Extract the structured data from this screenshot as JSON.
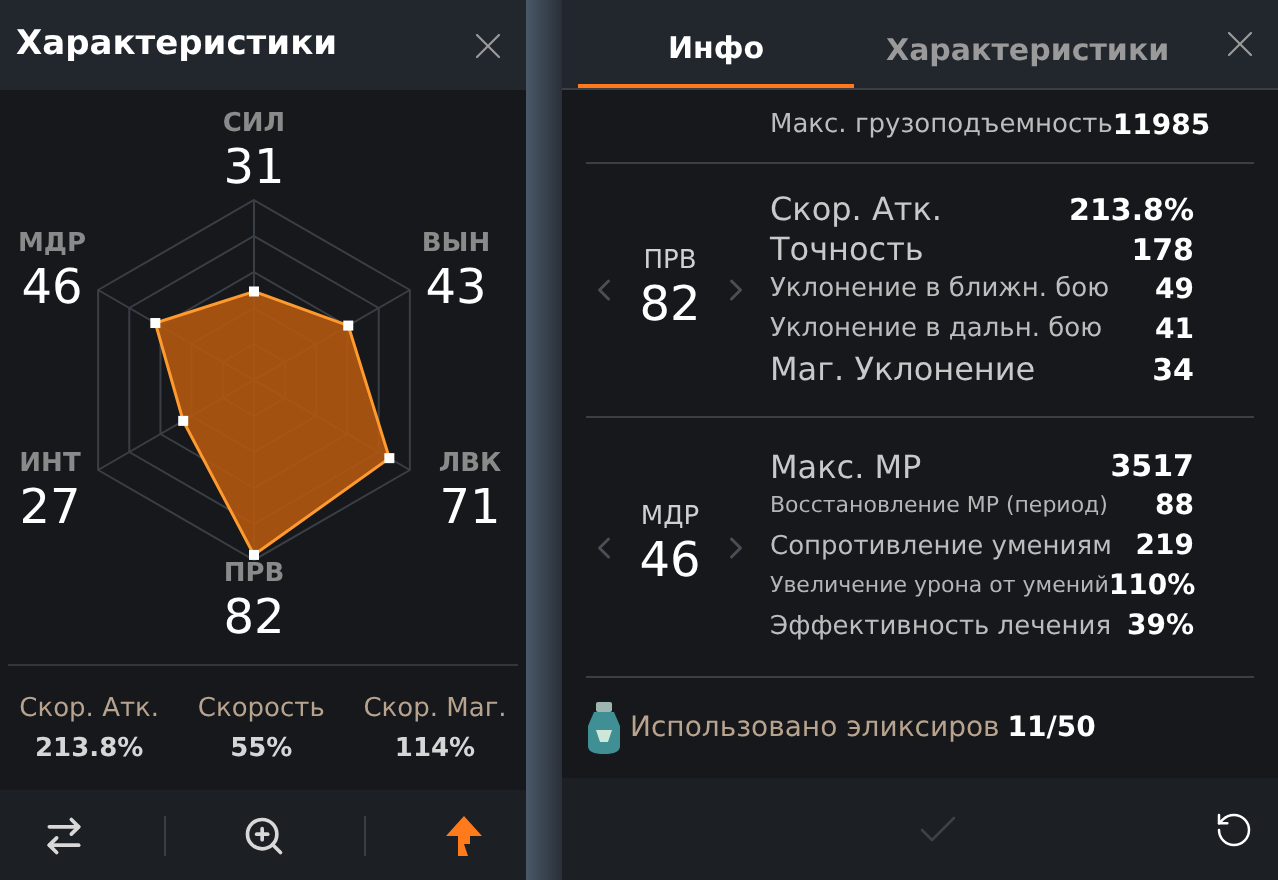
{
  "left_panel": {
    "title": "Характеристики",
    "stats": [
      {
        "label": "СИЛ",
        "value": "31"
      },
      {
        "label": "МДР",
        "value": "46"
      },
      {
        "label": "ВЫН",
        "value": "43"
      },
      {
        "label": "ИНТ",
        "value": "27"
      },
      {
        "label": "ЛВК",
        "value": "71"
      },
      {
        "label": "ПРВ",
        "value": "82"
      }
    ],
    "summary": [
      {
        "label": "Скор. Атк.",
        "value": "213.8%"
      },
      {
        "label": "Скорость",
        "value": "55%"
      },
      {
        "label": "Скор. Маг.",
        "value": "114%"
      }
    ],
    "toolbar": [
      {
        "kind": "swap",
        "active": false
      },
      {
        "kind": "zoom",
        "active": false
      },
      {
        "kind": "upgrade",
        "active": true
      }
    ]
  },
  "right_panel": {
    "tabs": [
      {
        "label": "Инфо",
        "selected": true
      },
      {
        "label": "Характеристики",
        "selected": false
      }
    ],
    "top_rows": [
      {
        "label": "Макс. грузоподъемность",
        "value": "11985",
        "kind": "small"
      }
    ],
    "sections": [
      {
        "attribute": "ПРВ",
        "value": "82",
        "rows": [
          {
            "label": "Скор. Атк.",
            "value": "213.8%",
            "kind": "large"
          },
          {
            "label": "Точность",
            "value": "178",
            "kind": "large"
          },
          {
            "label": "Уклонение в ближн. бою",
            "value": "49",
            "kind": "small"
          },
          {
            "label": "Уклонение в дальн. бою",
            "value": "41",
            "kind": "small"
          },
          {
            "label": "Маг. Уклонение",
            "value": "34",
            "kind": "large"
          }
        ]
      },
      {
        "attribute": "МДР",
        "value": "46",
        "rows": [
          {
            "label": "Макс. MP",
            "value": "3517",
            "kind": "large"
          },
          {
            "label": "Восстановление MP (период)",
            "value": "88",
            "kind": "tiny"
          },
          {
            "label": "Сопротивление умениям",
            "value": "219",
            "kind": "small"
          },
          {
            "label": "Увеличение урона от умений",
            "value": "110%",
            "kind": "tiny"
          },
          {
            "label": "Эффективность лечения",
            "value": "39%",
            "kind": "small"
          }
        ]
      }
    ],
    "elixirs": {
      "label": "Использовано эликсиров",
      "value": "11/50"
    },
    "confirm": {
      "disabled": true
    }
  }
}
